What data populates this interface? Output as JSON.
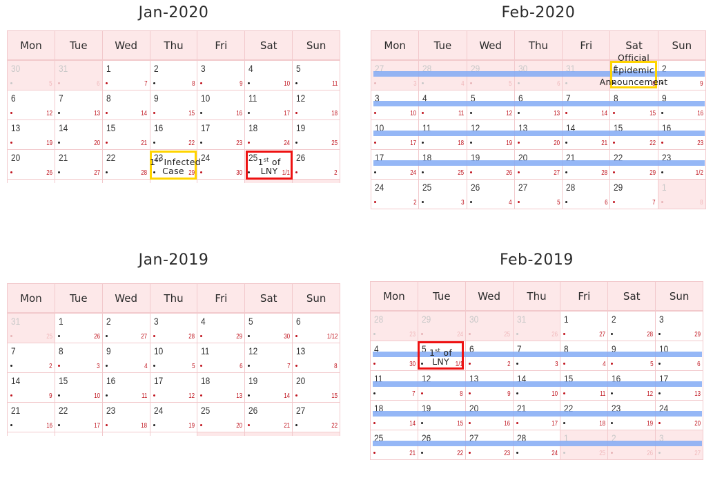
{
  "weekdays": [
    "Mon",
    "Tue",
    "Wed",
    "Thu",
    "Fri",
    "Sat",
    "Sun"
  ],
  "colors": {
    "header_bg": "#fde8e9",
    "border": "#f2c9cc",
    "lunar_text": "#c0141e",
    "highlight_bar": "#82aaf5",
    "annotation_yellow": "#ffd400",
    "annotation_red": "#ee1111"
  },
  "calendars": [
    {
      "id": "jan-2020",
      "title": "Jan-2020",
      "weeks": [
        [
          {
            "day": "30",
            "lunar": "5",
            "dot": "grey",
            "other": true
          },
          {
            "day": "31",
            "lunar": "6",
            "dot": "red",
            "other": true
          },
          {
            "day": "1",
            "lunar": "7",
            "dot": "red"
          },
          {
            "day": "2",
            "lunar": "8",
            "dot": "black"
          },
          {
            "day": "3",
            "lunar": "9",
            "dot": "red"
          },
          {
            "day": "4",
            "lunar": "10",
            "dot": "black"
          },
          {
            "day": "5",
            "lunar": "11",
            "dot": "black"
          }
        ],
        [
          {
            "day": "6",
            "lunar": "12",
            "dot": "red"
          },
          {
            "day": "7",
            "lunar": "13",
            "dot": "black"
          },
          {
            "day": "8",
            "lunar": "14",
            "dot": "red"
          },
          {
            "day": "9",
            "lunar": "15",
            "dot": "red"
          },
          {
            "day": "10",
            "lunar": "16",
            "dot": "black"
          },
          {
            "day": "11",
            "lunar": "17",
            "dot": "black"
          },
          {
            "day": "12",
            "lunar": "18",
            "dot": "red"
          }
        ],
        [
          {
            "day": "13",
            "lunar": "19",
            "dot": "red"
          },
          {
            "day": "14",
            "lunar": "20",
            "dot": "black"
          },
          {
            "day": "15",
            "lunar": "21",
            "dot": "red"
          },
          {
            "day": "16",
            "lunar": "22",
            "dot": "black"
          },
          {
            "day": "17",
            "lunar": "23",
            "dot": "black"
          },
          {
            "day": "18",
            "lunar": "24",
            "dot": "red"
          },
          {
            "day": "19",
            "lunar": "25",
            "dot": "black"
          }
        ],
        [
          {
            "day": "20",
            "lunar": "26",
            "dot": "red"
          },
          {
            "day": "21",
            "lunar": "27",
            "dot": "black"
          },
          {
            "day": "22",
            "lunar": "28",
            "dot": "black"
          },
          {
            "day": "23",
            "lunar": "29",
            "dot": "black"
          },
          {
            "day": "24",
            "lunar": "30",
            "dot": "red"
          },
          {
            "day": "25",
            "lunar": "1/1",
            "dot": "black"
          },
          {
            "day": "26",
            "lunar": "2",
            "dot": "red"
          }
        ]
      ],
      "partial_row_other": [
        false,
        false,
        false,
        false,
        false,
        true,
        true
      ],
      "annotations": [
        {
          "label": "1st Infected Case",
          "line1_pre": "1",
          "line1_sup": "st",
          "line1_post": " Infected",
          "line2": "Case",
          "style": "yellow"
        },
        {
          "label": "1st of LNY",
          "line1_pre": "1",
          "line1_sup": "st",
          "line1_post": " of",
          "line2": "LNY",
          "style": "red"
        }
      ]
    },
    {
      "id": "feb-2020",
      "title": "Feb-2020",
      "weeks": [
        [
          {
            "day": "27",
            "lunar": "3",
            "dot": "red",
            "other": true
          },
          {
            "day": "28",
            "lunar": "4",
            "dot": "grey",
            "other": true
          },
          {
            "day": "29",
            "lunar": "5",
            "dot": "red",
            "other": true
          },
          {
            "day": "30",
            "lunar": "6",
            "dot": "grey",
            "other": true
          },
          {
            "day": "31",
            "lunar": "7",
            "dot": "grey",
            "other": true
          },
          {
            "day": "1",
            "lunar": "8",
            "dot": "black"
          },
          {
            "day": "2",
            "lunar": "9",
            "dot": "black"
          }
        ],
        [
          {
            "day": "3",
            "lunar": "10",
            "dot": "red"
          },
          {
            "day": "4",
            "lunar": "11",
            "dot": "red"
          },
          {
            "day": "5",
            "lunar": "12",
            "dot": "black"
          },
          {
            "day": "6",
            "lunar": "13",
            "dot": "black"
          },
          {
            "day": "7",
            "lunar": "14",
            "dot": "red"
          },
          {
            "day": "8",
            "lunar": "15",
            "dot": "red"
          },
          {
            "day": "9",
            "lunar": "16",
            "dot": "black"
          }
        ],
        [
          {
            "day": "10",
            "lunar": "17",
            "dot": "red"
          },
          {
            "day": "11",
            "lunar": "18",
            "dot": "black"
          },
          {
            "day": "12",
            "lunar": "19",
            "dot": "black"
          },
          {
            "day": "13",
            "lunar": "20",
            "dot": "red"
          },
          {
            "day": "14",
            "lunar": "21",
            "dot": "black"
          },
          {
            "day": "15",
            "lunar": "22",
            "dot": "red"
          },
          {
            "day": "16",
            "lunar": "23",
            "dot": "red"
          }
        ],
        [
          {
            "day": "17",
            "lunar": "24",
            "dot": "black"
          },
          {
            "day": "18",
            "lunar": "25",
            "dot": "black"
          },
          {
            "day": "19",
            "lunar": "26",
            "dot": "red"
          },
          {
            "day": "20",
            "lunar": "27",
            "dot": "red"
          },
          {
            "day": "21",
            "lunar": "28",
            "dot": "black"
          },
          {
            "day": "22",
            "lunar": "29",
            "dot": "red"
          },
          {
            "day": "23",
            "lunar": "1/2",
            "dot": "black"
          }
        ],
        [
          {
            "day": "24",
            "lunar": "2",
            "dot": "red"
          },
          {
            "day": "25",
            "lunar": "3",
            "dot": "black"
          },
          {
            "day": "26",
            "lunar": "4",
            "dot": "black"
          },
          {
            "day": "27",
            "lunar": "5",
            "dot": "red"
          },
          {
            "day": "28",
            "lunar": "6",
            "dot": "black"
          },
          {
            "day": "29",
            "lunar": "7",
            "dot": "red"
          },
          {
            "day": "1",
            "lunar": "8",
            "dot": "red",
            "other": true
          }
        ]
      ],
      "annotations": [
        {
          "label": "Official Epidemic Announcement",
          "line1": "Official",
          "line2": "Epidemic",
          "line3": "Announcement",
          "style": "yellow"
        }
      ]
    },
    {
      "id": "jan-2019",
      "title": "Jan-2019",
      "weeks": [
        [
          {
            "day": "31",
            "lunar": "25",
            "dot": "red",
            "other": true
          },
          {
            "day": "1",
            "lunar": "26",
            "dot": "black"
          },
          {
            "day": "2",
            "lunar": "27",
            "dot": "black"
          },
          {
            "day": "3",
            "lunar": "28",
            "dot": "red"
          },
          {
            "day": "4",
            "lunar": "29",
            "dot": "red"
          },
          {
            "day": "5",
            "lunar": "30",
            "dot": "black"
          },
          {
            "day": "6",
            "lunar": "1/12",
            "dot": "red"
          }
        ],
        [
          {
            "day": "7",
            "lunar": "2",
            "dot": "black"
          },
          {
            "day": "8",
            "lunar": "3",
            "dot": "red"
          },
          {
            "day": "9",
            "lunar": "4",
            "dot": "black"
          },
          {
            "day": "10",
            "lunar": "5",
            "dot": "black"
          },
          {
            "day": "11",
            "lunar": "6",
            "dot": "red"
          },
          {
            "day": "12",
            "lunar": "7",
            "dot": "black"
          },
          {
            "day": "13",
            "lunar": "8",
            "dot": "red"
          }
        ],
        [
          {
            "day": "14",
            "lunar": "9",
            "dot": "red"
          },
          {
            "day": "15",
            "lunar": "10",
            "dot": "black"
          },
          {
            "day": "16",
            "lunar": "11",
            "dot": "black"
          },
          {
            "day": "17",
            "lunar": "12",
            "dot": "red"
          },
          {
            "day": "18",
            "lunar": "13",
            "dot": "red"
          },
          {
            "day": "19",
            "lunar": "14",
            "dot": "black"
          },
          {
            "day": "20",
            "lunar": "15",
            "dot": "red"
          }
        ],
        [
          {
            "day": "21",
            "lunar": "16",
            "dot": "black"
          },
          {
            "day": "22",
            "lunar": "17",
            "dot": "black"
          },
          {
            "day": "23",
            "lunar": "18",
            "dot": "red"
          },
          {
            "day": "24",
            "lunar": "19",
            "dot": "black"
          },
          {
            "day": "25",
            "lunar": "20",
            "dot": "red"
          },
          {
            "day": "26",
            "lunar": "21",
            "dot": "red"
          },
          {
            "day": "27",
            "lunar": "22",
            "dot": "black"
          }
        ]
      ],
      "partial_row_other": [
        false,
        false,
        false,
        false,
        true,
        true,
        true
      ],
      "annotations": []
    },
    {
      "id": "feb-2019",
      "title": "Feb-2019",
      "weeks": [
        [
          {
            "day": "28",
            "lunar": "23",
            "dot": "grey",
            "other": true
          },
          {
            "day": "29",
            "lunar": "24",
            "dot": "red",
            "other": true
          },
          {
            "day": "30",
            "lunar": "25",
            "dot": "red",
            "other": true
          },
          {
            "day": "31",
            "lunar": "26",
            "dot": "grey",
            "other": true
          },
          {
            "day": "1",
            "lunar": "27",
            "dot": "red"
          },
          {
            "day": "2",
            "lunar": "28",
            "dot": "black"
          },
          {
            "day": "3",
            "lunar": "29",
            "dot": "black"
          }
        ],
        [
          {
            "day": "4",
            "lunar": "30",
            "dot": "red"
          },
          {
            "day": "5",
            "lunar": "1/1",
            "dot": "black"
          },
          {
            "day": "6",
            "lunar": "2",
            "dot": "red"
          },
          {
            "day": "7",
            "lunar": "3",
            "dot": "black"
          },
          {
            "day": "8",
            "lunar": "4",
            "dot": "red"
          },
          {
            "day": "9",
            "lunar": "5",
            "dot": "red"
          },
          {
            "day": "10",
            "lunar": "6",
            "dot": "black"
          }
        ],
        [
          {
            "day": "11",
            "lunar": "7",
            "dot": "black"
          },
          {
            "day": "12",
            "lunar": "8",
            "dot": "red"
          },
          {
            "day": "13",
            "lunar": "9",
            "dot": "red"
          },
          {
            "day": "14",
            "lunar": "10",
            "dot": "black"
          },
          {
            "day": "15",
            "lunar": "11",
            "dot": "red"
          },
          {
            "day": "16",
            "lunar": "12",
            "dot": "black"
          },
          {
            "day": "17",
            "lunar": "13",
            "dot": "black"
          }
        ],
        [
          {
            "day": "18",
            "lunar": "14",
            "dot": "red"
          },
          {
            "day": "19",
            "lunar": "15",
            "dot": "black"
          },
          {
            "day": "20",
            "lunar": "16",
            "dot": "red"
          },
          {
            "day": "21",
            "lunar": "17",
            "dot": "red"
          },
          {
            "day": "22",
            "lunar": "18",
            "dot": "black"
          },
          {
            "day": "23",
            "lunar": "19",
            "dot": "black"
          },
          {
            "day": "24",
            "lunar": "20",
            "dot": "red"
          }
        ],
        [
          {
            "day": "25",
            "lunar": "21",
            "dot": "red"
          },
          {
            "day": "26",
            "lunar": "22",
            "dot": "black"
          },
          {
            "day": "27",
            "lunar": "23",
            "dot": "red"
          },
          {
            "day": "28",
            "lunar": "24",
            "dot": "black"
          },
          {
            "day": "1",
            "lunar": "25",
            "dot": "grey",
            "other": true
          },
          {
            "day": "2",
            "lunar": "26",
            "dot": "red",
            "other": true
          },
          {
            "day": "3",
            "lunar": "27",
            "dot": "grey",
            "other": true
          }
        ]
      ],
      "annotations": [
        {
          "label": "1st of LNY",
          "line1_pre": "1",
          "line1_sup": "st",
          "line1_post": " of",
          "line2": "LNY",
          "style": "red"
        }
      ]
    }
  ]
}
